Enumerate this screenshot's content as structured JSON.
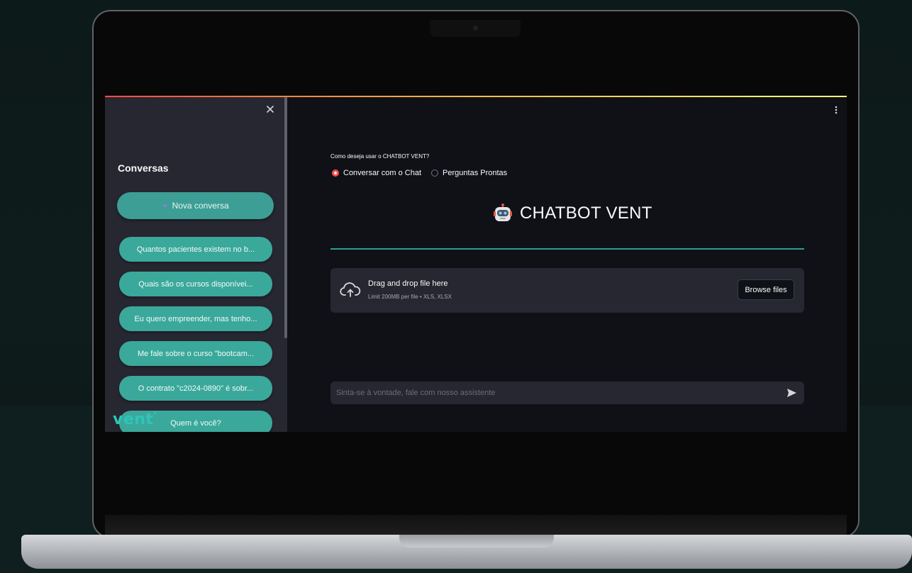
{
  "sidebar": {
    "heading": "Conversas",
    "new_chat_label": "Nova conversa",
    "history": [
      "Quantos pacientes existem no b...",
      "Quais são os cursos disponívei...",
      "Eu quero empreender, mas tenho...",
      "Me fale sobre o curso \"bootcam...",
      "O contrato \"c2024-0890\" é sobr...",
      "Quem é você?"
    ],
    "logo_text": "vent"
  },
  "main": {
    "radio_question": "Como deseja usar o CHATBOT VENT?",
    "radio_options": [
      {
        "label": "Conversar com o Chat",
        "selected": true
      },
      {
        "label": "Perguntas Prontas",
        "selected": false
      }
    ],
    "title": "CHATBOT VENT",
    "uploader": {
      "title": "Drag and drop file here",
      "limit": "Limit 200MB per file • XLS, XLSX",
      "browse_label": "Browse files"
    },
    "chat_input": {
      "placeholder": "Sinta-se à vontade, fale com nosso assistente",
      "value": ""
    }
  },
  "colors": {
    "accent_teal": "#3aa89b",
    "radio_selected": "#ff4b4b",
    "sidebar_bg": "#262730",
    "app_bg": "#0f1117"
  },
  "icons": [
    "close-icon",
    "sparkle-icon",
    "robot-icon",
    "upload-cloud-icon",
    "send-icon",
    "menu-icon"
  ]
}
